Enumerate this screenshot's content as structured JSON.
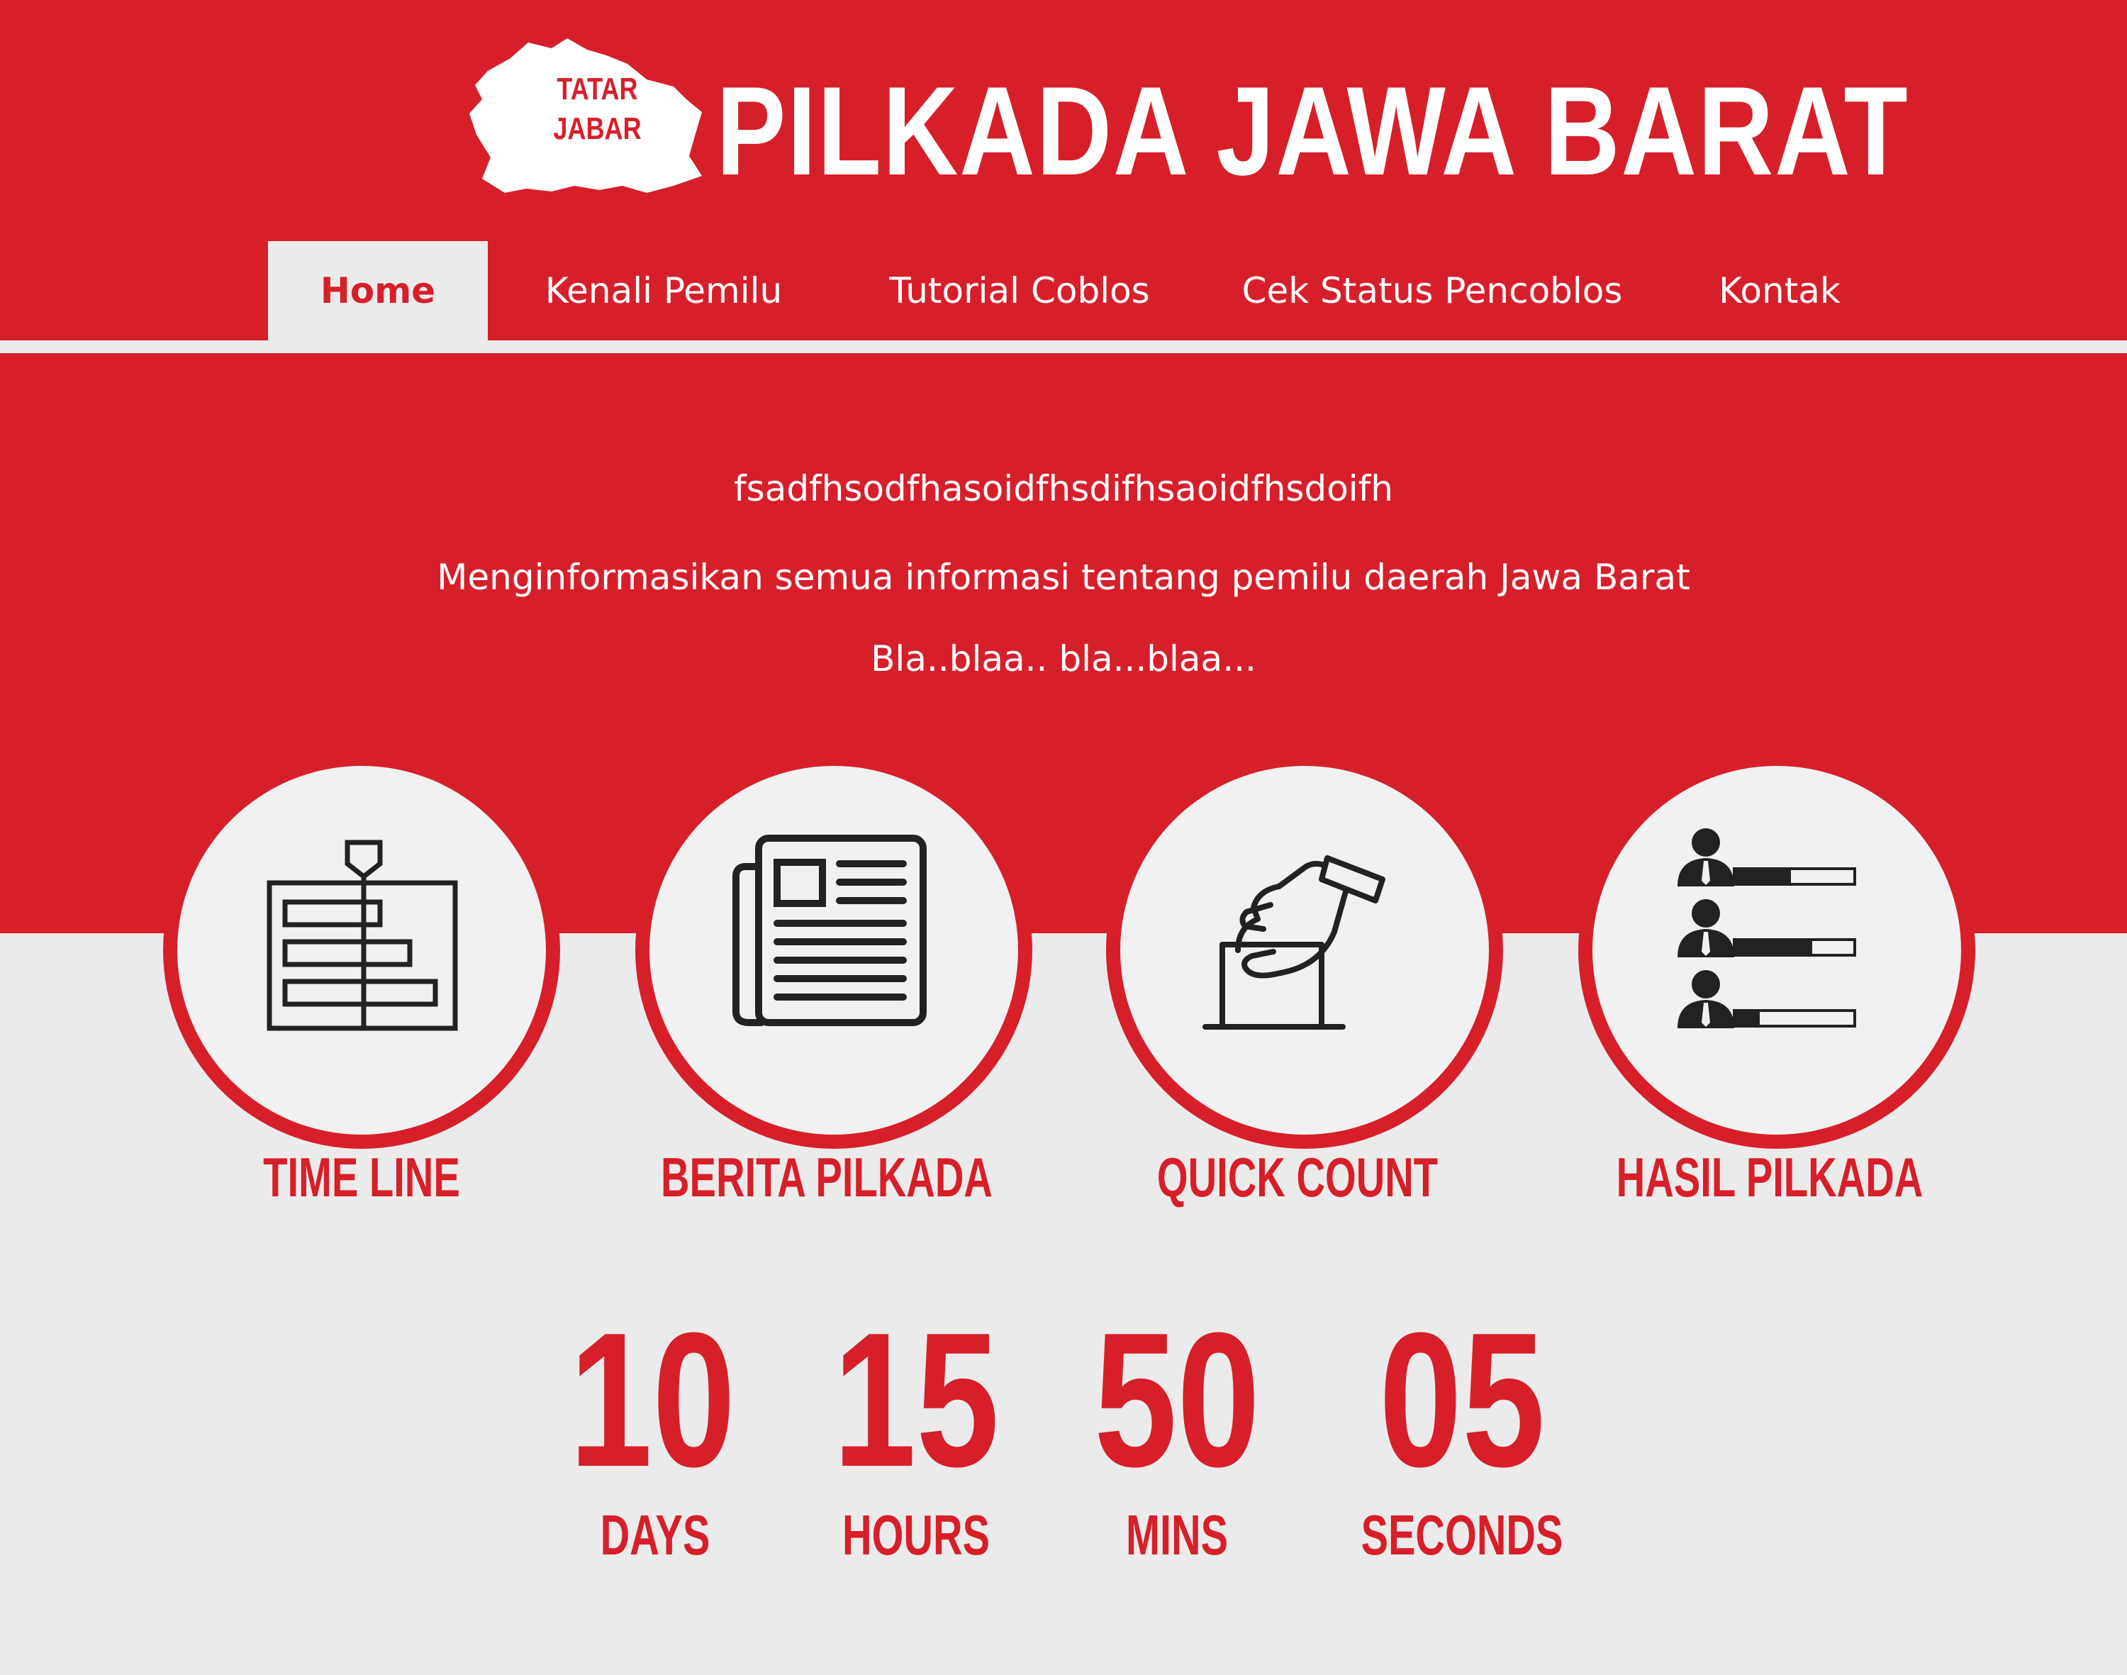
{
  "header": {
    "logo_line1": "TATAR",
    "logo_line2": "JABAR",
    "title": "PILKADA JAWA BARAT"
  },
  "nav": {
    "items": [
      {
        "label": "Home",
        "active": true
      },
      {
        "label": "Kenali Pemilu",
        "active": false
      },
      {
        "label": "Tutorial Coblos",
        "active": false
      },
      {
        "label": "Cek Status Pencoblos",
        "active": false
      },
      {
        "label": "Kontak",
        "active": false
      }
    ]
  },
  "hero": {
    "line1": "fsadfhsodfhasoidfhsdifhsaoidfhsdoifh",
    "line2": "Menginformasikan semua informasi tentang pemilu daerah Jawa Barat",
    "line3": "Bla..blaa.. bla...blaa..."
  },
  "features": [
    {
      "label": "TIME LINE",
      "icon": "timeline-icon"
    },
    {
      "label": "BERITA PILKADA",
      "icon": "newspaper-icon"
    },
    {
      "label": "QUICK COUNT",
      "icon": "ballot-box-icon"
    },
    {
      "label": "HASIL PILKADA",
      "icon": "candidates-results-icon"
    }
  ],
  "countdown": [
    {
      "value": "10",
      "unit": "DAYS"
    },
    {
      "value": "15",
      "unit": "HOURS"
    },
    {
      "value": "50",
      "unit": "MINS"
    },
    {
      "value": "05",
      "unit": "SECONDS"
    }
  ],
  "colors": {
    "brand_red": "#d71f2a",
    "background": "#ebebeb",
    "icon_dark": "#222222"
  }
}
